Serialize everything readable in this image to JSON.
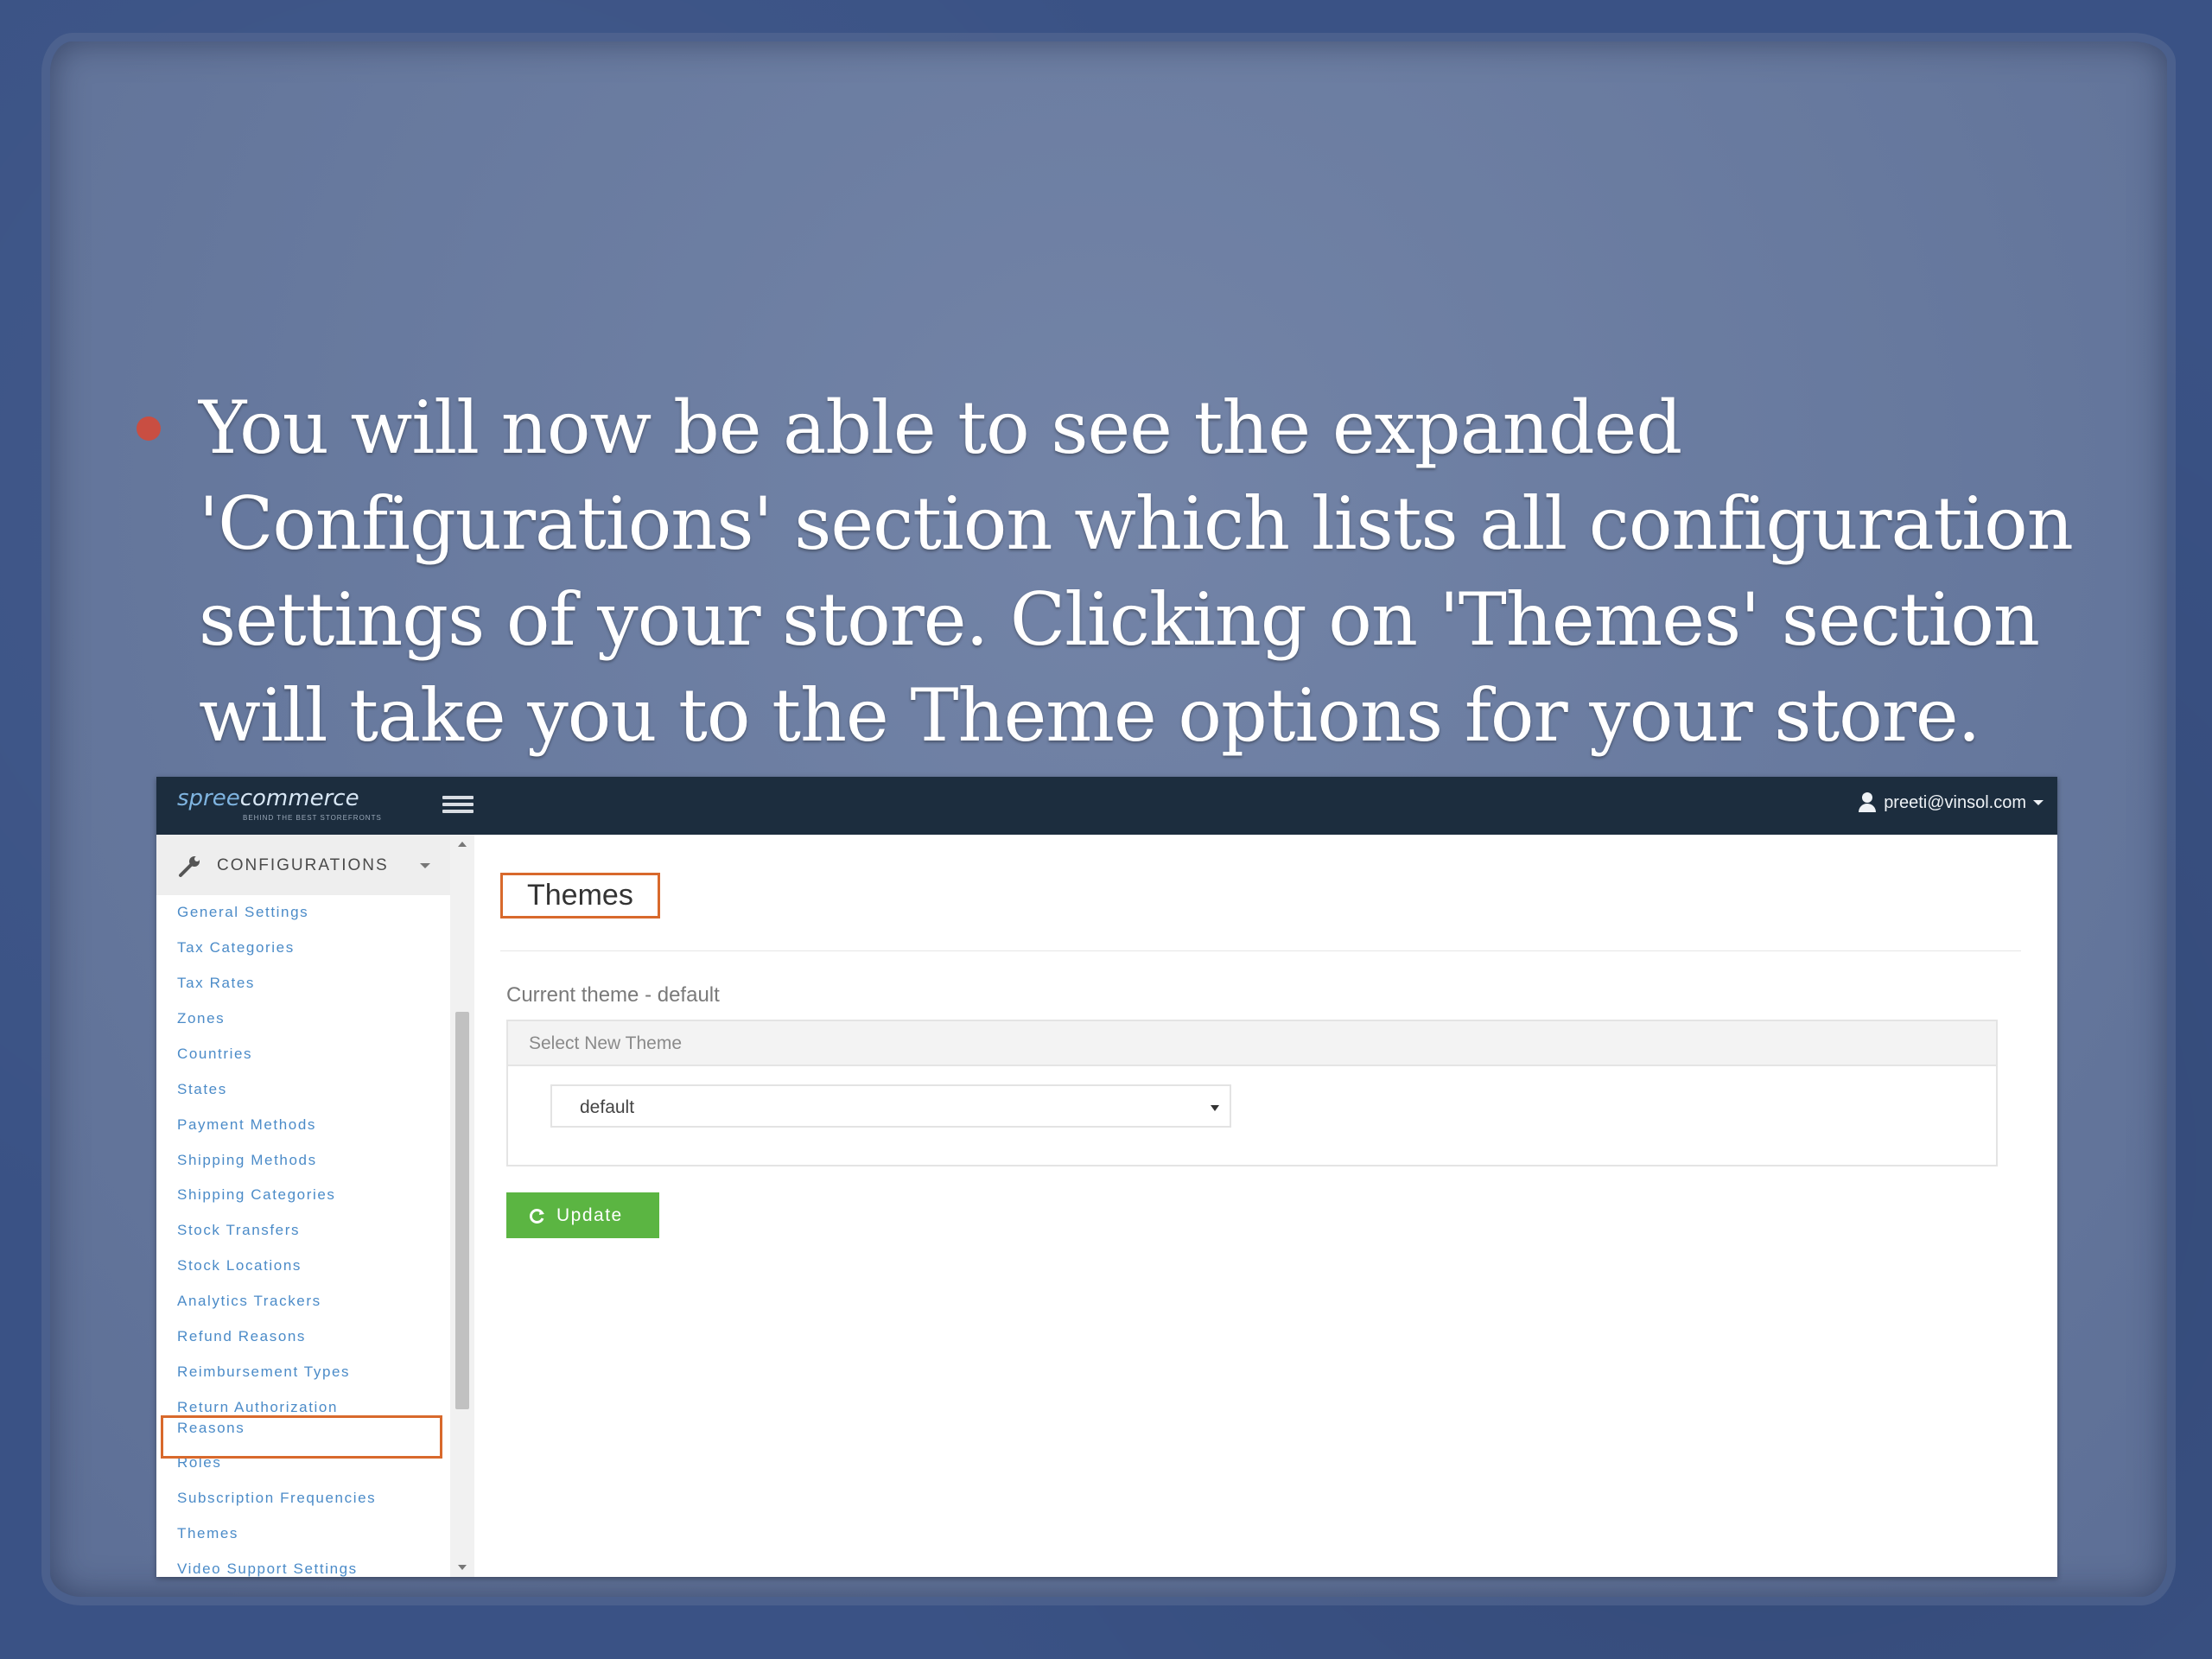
{
  "slide": {
    "bullet_text": "You will now be able to see the expanded 'Configurations' section which lists all configuration settings of your store. Clicking on 'Themes' section will take you to the Theme options for your store."
  },
  "header": {
    "logo_part1": "spree",
    "logo_part2": "commerce",
    "logo_tagline": "BEHIND THE BEST STOREFRONTS",
    "user_email": "preeti@vinsol.com"
  },
  "sidebar": {
    "section_title": "CONFIGURATIONS",
    "items": [
      {
        "label": "General Settings"
      },
      {
        "label": "Tax Categories"
      },
      {
        "label": "Tax Rates"
      },
      {
        "label": "Zones"
      },
      {
        "label": "Countries"
      },
      {
        "label": "States"
      },
      {
        "label": "Payment Methods"
      },
      {
        "label": "Shipping Methods"
      },
      {
        "label": "Shipping Categories"
      },
      {
        "label": "Stock Transfers"
      },
      {
        "label": "Stock Locations"
      },
      {
        "label": "Analytics Trackers"
      },
      {
        "label": "Refund Reasons"
      },
      {
        "label": "Reimbursement Types"
      },
      {
        "label": "Return Authorization Reasons"
      },
      {
        "label": "Roles"
      },
      {
        "label": "Subscription Frequencies"
      },
      {
        "label": "Themes"
      },
      {
        "label": "Video Support Settings"
      }
    ]
  },
  "main": {
    "page_title": "Themes",
    "current_theme_label": "Current theme - default",
    "panel_heading": "Select New Theme",
    "theme_select_value": "default",
    "update_button_label": "Update"
  },
  "colors": {
    "topbar": "#1c2d3e",
    "link": "#4b8bc8",
    "highlight": "#d8692c",
    "update_button": "#5bb542",
    "bullet": "#c94e42"
  }
}
